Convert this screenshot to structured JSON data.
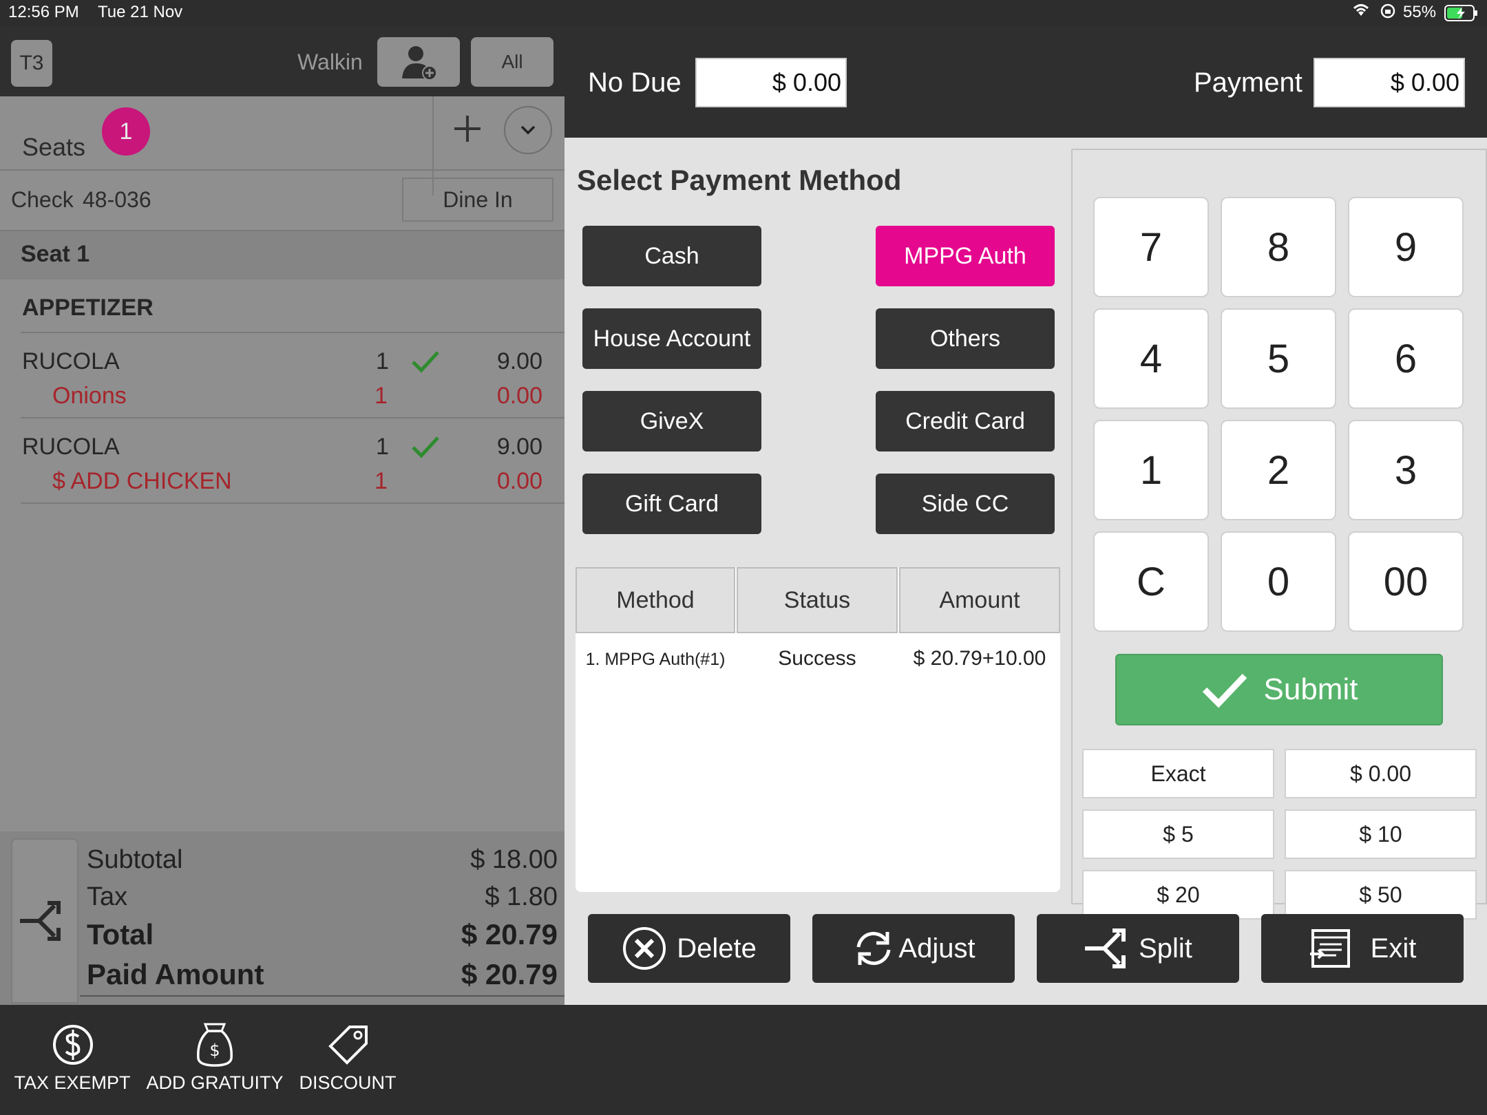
{
  "status_bar": {
    "time": "12:56 PM",
    "date": "Tue 21 Nov",
    "battery": "55%"
  },
  "order": {
    "table": "T3",
    "customer": "Walkin",
    "all_label": "All",
    "seats_label": "Seats",
    "seat_count": "1",
    "check_label": "Check",
    "check_number": "48-036",
    "dine_in": "Dine In",
    "seat_header": "Seat 1",
    "category": "APPETIZER",
    "items": [
      {
        "name": "RUCOLA",
        "qty": "1",
        "price": "9.00",
        "mod_name": "Onions",
        "mod_qty": "1",
        "mod_price": "0.00"
      },
      {
        "name": "RUCOLA",
        "qty": "1",
        "price": "9.00",
        "mod_name": "$ ADD CHICKEN",
        "mod_qty": "1",
        "mod_price": "0.00"
      }
    ],
    "totals": {
      "subtotal_label": "Subtotal",
      "subtotal": "$ 18.00",
      "tax_label": "Tax",
      "tax": "$ 1.80",
      "total_label": "Total",
      "total": "$ 20.79",
      "paid_label": "Paid Amount",
      "paid": "$ 20.79"
    }
  },
  "payment": {
    "no_due_label": "No Due",
    "no_due_value": "$ 0.00",
    "payment_label": "Payment",
    "payment_value": "$ 0.00",
    "select_title": "Select Payment Method",
    "methods": [
      "Cash",
      "MPPG Auth",
      "House Account",
      "Others",
      "GiveX",
      "Credit Card",
      "Gift Card",
      "Side CC"
    ],
    "selected_method": "MPPG Auth",
    "table_headers": [
      "Method",
      "Status",
      "Amount"
    ],
    "transactions": [
      {
        "method": "1. MPPG Auth(#1)",
        "status": "Success",
        "amount": "$ 20.79+10.00"
      }
    ],
    "keypad": [
      "7",
      "8",
      "9",
      "4",
      "5",
      "6",
      "1",
      "2",
      "3",
      "C",
      "0",
      "00"
    ],
    "submit": "Submit",
    "quick_amounts": [
      "Exact",
      "$ 0.00",
      "$ 5",
      "$ 10",
      "$ 20",
      "$ 50"
    ],
    "actions": {
      "delete": "Delete",
      "adjust": "Adjust",
      "split": "Split",
      "exit": "Exit"
    }
  },
  "bottom_bar": {
    "tax_exempt": "TAX EXEMPT",
    "add_gratuity": "ADD GRATUITY",
    "discount": "DISCOUNT"
  },
  "colors": {
    "accent": "#e5078e",
    "submit": "#56b36b",
    "dark": "#2f2f2f",
    "modifier": "#a6242b",
    "check": "#2e8b2e"
  }
}
